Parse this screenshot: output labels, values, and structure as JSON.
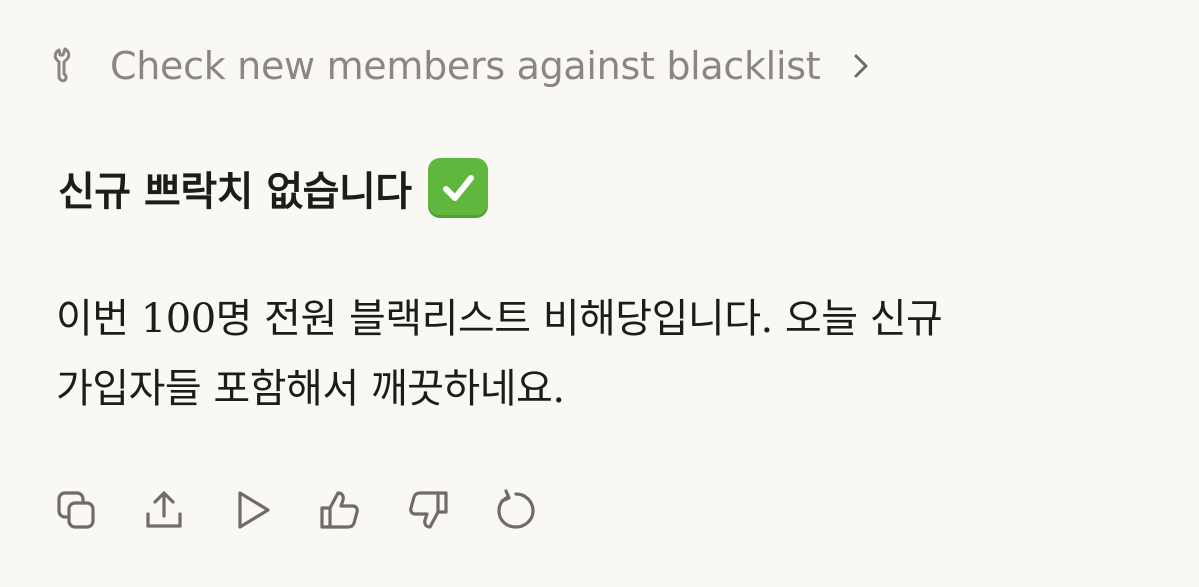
{
  "tool_call": {
    "icon": "wrench-icon",
    "label": "Check new members against blacklist",
    "chevron_icon": "chevron-right-icon"
  },
  "message": {
    "heading": "신규 쁘락치 없습니다",
    "heading_emoji": "check-mark-button-icon",
    "body_lines": [
      "이번 100명 전원 블랙리스트 비해당입니다. 오늘 신규",
      "가입자들 포함해서 깨끗하네요."
    ]
  },
  "actions": [
    {
      "name": "copy-button",
      "icon": "copy-icon"
    },
    {
      "name": "share-button",
      "icon": "share-icon"
    },
    {
      "name": "play-button",
      "icon": "play-icon"
    },
    {
      "name": "thumbs-up-button",
      "icon": "thumbs-up-icon"
    },
    {
      "name": "thumbs-down-button",
      "icon": "thumbs-down-icon"
    },
    {
      "name": "retry-button",
      "icon": "retry-icon"
    }
  ],
  "colors": {
    "background": "#f9f8f4",
    "text": "#1d1c1a",
    "muted": "#8a8782",
    "icon": "#6f6c67",
    "check_green": "#5fb83d"
  }
}
